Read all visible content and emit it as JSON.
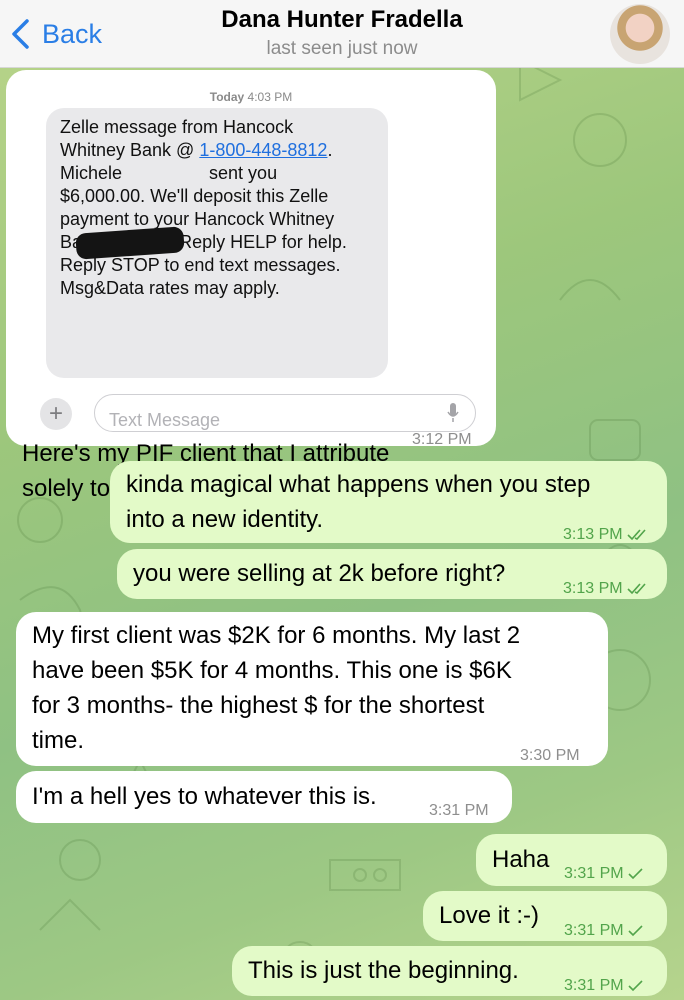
{
  "header": {
    "back_label": "Back",
    "title": "Dana Hunter Fradella",
    "status": "last seen just now"
  },
  "first_message": {
    "screenshot": {
      "date_day": "Today",
      "date_time": "4:03 PM",
      "sms_line1": "Zelle message from Hancock",
      "sms_line2a": "Whitney Bank @ ",
      "sms_phone": "1-800-448-8812",
      "sms_line2b": ".",
      "sms_line3a": "Michele ",
      "sms_line3b": "sent you",
      "sms_line4": "$6,000.00.  We'll deposit this Zelle",
      "sms_line5": "payment to your Hancock Whitney",
      "sms_line6": "Bank account. Reply HELP for help.",
      "sms_line7": "Reply STOP to end text messages.",
      "sms_line8": "Msg&Data rates may apply.",
      "input_placeholder": "Text Message"
    },
    "caption_line1": "Here's my PIF client that I attribute",
    "caption_line2": "solely to signing up with you.",
    "time": "3:12 PM"
  },
  "messages": [
    {
      "line1": "kinda magical what happens when you step",
      "line2": "into a new identity.",
      "time": "3:13 PM",
      "status": "read"
    },
    {
      "text": "you were selling at 2k before right?",
      "time": "3:13 PM",
      "status": "read"
    },
    {
      "line1": "My first client was $2K for 6 months. My last 2",
      "line2": "have been $5K for 4 months. This one is $6K",
      "line3": "for 3 months- the highest $ for the shortest",
      "line4": "time.",
      "time": "3:30 PM"
    },
    {
      "text": "I'm a hell yes to whatever this is.",
      "time": "3:31 PM"
    },
    {
      "text": "Haha",
      "time": "3:31 PM",
      "status": "delivered"
    },
    {
      "text": "Love it :-)",
      "time": "3:31 PM",
      "status": "delivered"
    },
    {
      "text": "This is just the beginning.",
      "time": "3:31 PM",
      "status": "delivered"
    }
  ],
  "colors": {
    "accent": "#2a7ee6",
    "incoming_bubble": "#ffffff",
    "outgoing_bubble": "#e3fac8",
    "outgoing_time": "#52a44b"
  }
}
